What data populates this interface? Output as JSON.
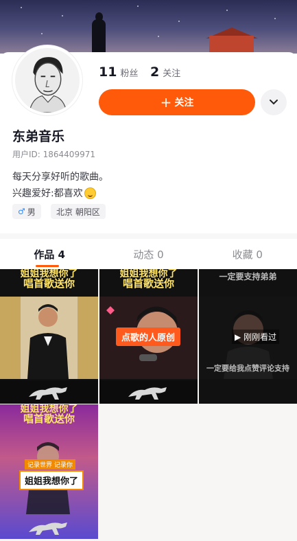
{
  "profile": {
    "followers_count": "11",
    "followers_label": "粉丝",
    "following_count": "2",
    "following_label": "关注",
    "follow_button_label": "关注",
    "name": "东弟音乐",
    "user_id": "用户ID: 1864409971",
    "bio_line1": "每天分享好听的歌曲。",
    "bio_line2": "兴趣爱好:都喜欢",
    "gender_tag": "男",
    "location_tag": "北京 朝阳区"
  },
  "tabs": [
    {
      "label": "作品 4",
      "active": true
    },
    {
      "label": "动态 0",
      "active": false
    },
    {
      "label": "收藏 0",
      "active": false
    }
  ],
  "videos": [
    {
      "caption_top": "姐姐我想你了",
      "caption_main": "唱首歌送你"
    },
    {
      "caption_top": "姐姐我想你了",
      "caption_main": "唱首歌送你",
      "overlay_label": "点歌的人原创"
    },
    {
      "caption_top": "一定要支持弟弟",
      "watched_label": "刚刚看过",
      "bottom_text": "一定要给我点赞评论支持"
    },
    {
      "caption_top": "姐姐我想你了",
      "caption_main": "唱首歌送你",
      "badge_text": "记录世界 记录你",
      "overlay_label": "姐姐我想你了"
    }
  ],
  "colors": {
    "accent": "#ff5a0a",
    "caption_yellow": "#ffe46b"
  },
  "icons": {
    "more": "chevron-down-icon",
    "gender": "male-icon",
    "play": "play-icon"
  }
}
